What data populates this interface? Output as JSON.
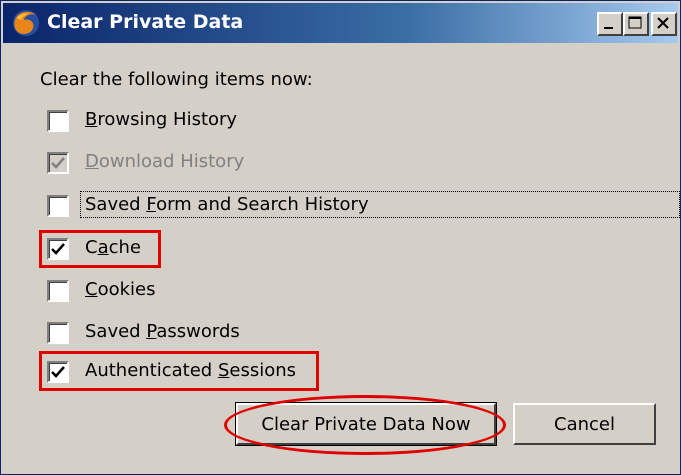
{
  "window": {
    "title": "Clear Private Data",
    "controls": {
      "minimize": "minimize",
      "maximize": "maximize",
      "close": "close"
    }
  },
  "dialog": {
    "instruction": "Clear the following items now:",
    "options": [
      {
        "pre": "",
        "key": "B",
        "post": "rowsing History",
        "checked": false,
        "enabled": true
      },
      {
        "pre": "",
        "key": "D",
        "post": "ownload History",
        "checked": true,
        "enabled": false
      },
      {
        "pre": "Saved ",
        "key": "F",
        "post": "orm and Search History",
        "checked": false,
        "enabled": true,
        "focused": true
      },
      {
        "pre": "C",
        "key": "a",
        "post": "che",
        "checked": true,
        "enabled": true,
        "highlighted": true
      },
      {
        "pre": "",
        "key": "C",
        "post": "ookies",
        "checked": false,
        "enabled": true
      },
      {
        "pre": "Saved ",
        "key": "P",
        "post": "asswords",
        "checked": false,
        "enabled": true
      },
      {
        "pre": "Authenticated ",
        "key": "S",
        "post": "essions",
        "checked": true,
        "enabled": true,
        "highlighted": true
      }
    ],
    "buttons": {
      "clear_now": "Clear Private Data Now",
      "cancel": "Cancel"
    }
  },
  "annotation_color": "#e00000"
}
